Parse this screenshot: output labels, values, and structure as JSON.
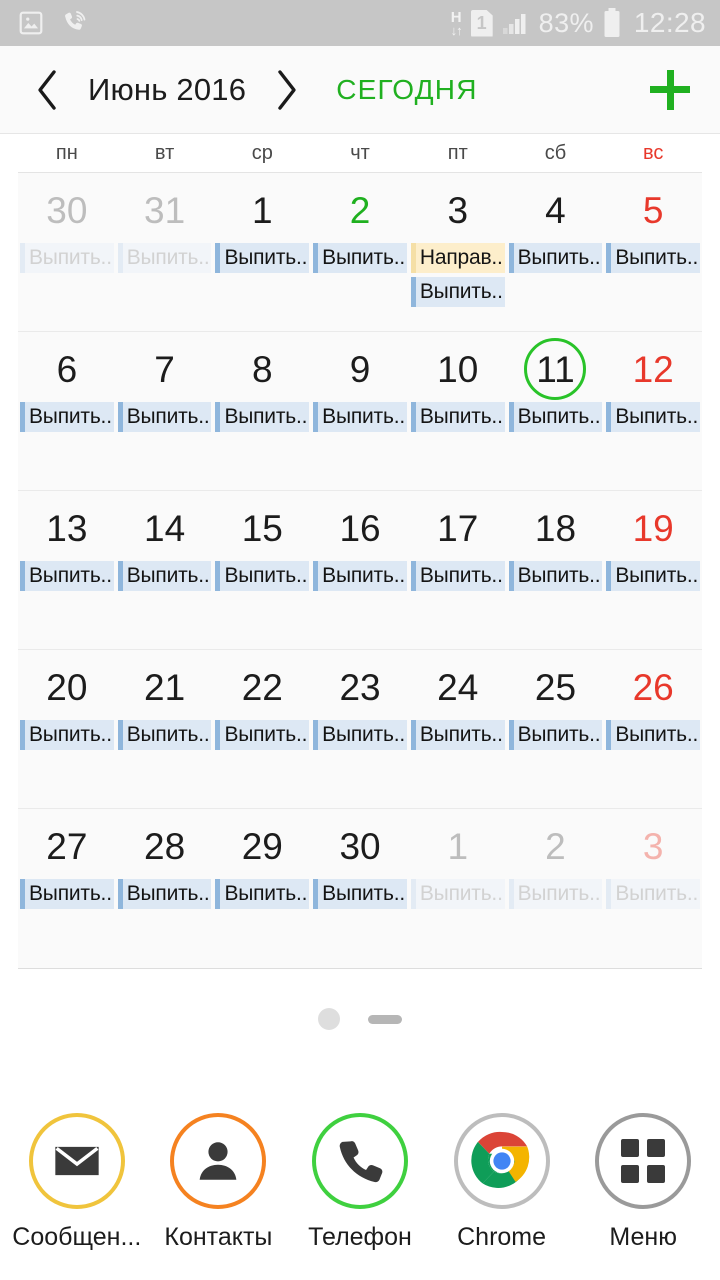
{
  "status_bar": {
    "left_icons": [
      {
        "name": "photo-icon",
        "glyph": "image"
      },
      {
        "name": "call-sound-icon",
        "glyph": "phone-waves"
      }
    ],
    "data_network": "H",
    "data_arrows": "↓↑",
    "sim_slot": "1",
    "signal": "signal-bars",
    "battery_percent": "83%",
    "clock": "12:28",
    "background": "#c6c6c6",
    "foreground": "#efefef"
  },
  "header": {
    "prev_label": "❮",
    "month_title": "Июнь 2016",
    "next_label": "❯",
    "today_label": "СЕГОДНЯ",
    "add_label": "+",
    "accent_color": "#20b020"
  },
  "weekdays": [
    {
      "label": "пн",
      "sunday": false
    },
    {
      "label": "вт",
      "sunday": false
    },
    {
      "label": "ср",
      "sunday": false
    },
    {
      "label": "чт",
      "sunday": false
    },
    {
      "label": "пт",
      "sunday": false
    },
    {
      "label": "сб",
      "sunday": false
    },
    {
      "label": "вс",
      "sunday": true
    }
  ],
  "calendar": {
    "event_drink": "Выпить..",
    "event_send": "Направ..",
    "today_day": "11",
    "weeks": [
      {
        "days": [
          {
            "num": "30",
            "out": true,
            "sunday": false,
            "today": false,
            "green": false,
            "events": [
              {
                "text": "Выпить..",
                "style": "faded"
              }
            ]
          },
          {
            "num": "31",
            "out": true,
            "sunday": false,
            "today": false,
            "green": false,
            "events": [
              {
                "text": "Выпить..",
                "style": "faded"
              }
            ]
          },
          {
            "num": "1",
            "out": false,
            "sunday": false,
            "today": false,
            "green": false,
            "events": [
              {
                "text": "Выпить..",
                "style": "blue"
              }
            ]
          },
          {
            "num": "2",
            "out": false,
            "sunday": false,
            "today": false,
            "green": true,
            "events": [
              {
                "text": "Выпить..",
                "style": "blue"
              }
            ]
          },
          {
            "num": "3",
            "out": false,
            "sunday": false,
            "today": false,
            "green": false,
            "events": [
              {
                "text": "Направ..",
                "style": "tan"
              },
              {
                "text": "Выпить..",
                "style": "blue"
              }
            ]
          },
          {
            "num": "4",
            "out": false,
            "sunday": false,
            "today": false,
            "green": false,
            "events": [
              {
                "text": "Выпить..",
                "style": "blue"
              }
            ]
          },
          {
            "num": "5",
            "out": false,
            "sunday": true,
            "today": false,
            "green": false,
            "events": [
              {
                "text": "Выпить..",
                "style": "blue"
              }
            ]
          }
        ]
      },
      {
        "days": [
          {
            "num": "6",
            "out": false,
            "sunday": false,
            "today": false,
            "green": false,
            "events": [
              {
                "text": "Выпить..",
                "style": "blue"
              }
            ]
          },
          {
            "num": "7",
            "out": false,
            "sunday": false,
            "today": false,
            "green": false,
            "events": [
              {
                "text": "Выпить..",
                "style": "blue"
              }
            ]
          },
          {
            "num": "8",
            "out": false,
            "sunday": false,
            "today": false,
            "green": false,
            "events": [
              {
                "text": "Выпить..",
                "style": "blue"
              }
            ]
          },
          {
            "num": "9",
            "out": false,
            "sunday": false,
            "today": false,
            "green": false,
            "events": [
              {
                "text": "Выпить..",
                "style": "blue"
              }
            ]
          },
          {
            "num": "10",
            "out": false,
            "sunday": false,
            "today": false,
            "green": false,
            "events": [
              {
                "text": "Выпить..",
                "style": "blue"
              }
            ]
          },
          {
            "num": "11",
            "out": false,
            "sunday": false,
            "today": true,
            "green": false,
            "events": [
              {
                "text": "Выпить..",
                "style": "blue"
              }
            ]
          },
          {
            "num": "12",
            "out": false,
            "sunday": true,
            "today": false,
            "green": false,
            "events": [
              {
                "text": "Выпить..",
                "style": "blue"
              }
            ]
          }
        ]
      },
      {
        "days": [
          {
            "num": "13",
            "out": false,
            "sunday": false,
            "today": false,
            "green": false,
            "events": [
              {
                "text": "Выпить..",
                "style": "blue"
              }
            ]
          },
          {
            "num": "14",
            "out": false,
            "sunday": false,
            "today": false,
            "green": false,
            "events": [
              {
                "text": "Выпить..",
                "style": "blue"
              }
            ]
          },
          {
            "num": "15",
            "out": false,
            "sunday": false,
            "today": false,
            "green": false,
            "events": [
              {
                "text": "Выпить..",
                "style": "blue"
              }
            ]
          },
          {
            "num": "16",
            "out": false,
            "sunday": false,
            "today": false,
            "green": false,
            "events": [
              {
                "text": "Выпить..",
                "style": "blue"
              }
            ]
          },
          {
            "num": "17",
            "out": false,
            "sunday": false,
            "today": false,
            "green": false,
            "events": [
              {
                "text": "Выпить..",
                "style": "blue"
              }
            ]
          },
          {
            "num": "18",
            "out": false,
            "sunday": false,
            "today": false,
            "green": false,
            "events": [
              {
                "text": "Выпить..",
                "style": "blue"
              }
            ]
          },
          {
            "num": "19",
            "out": false,
            "sunday": true,
            "today": false,
            "green": false,
            "events": [
              {
                "text": "Выпить..",
                "style": "blue"
              }
            ]
          }
        ]
      },
      {
        "days": [
          {
            "num": "20",
            "out": false,
            "sunday": false,
            "today": false,
            "green": false,
            "events": [
              {
                "text": "Выпить..",
                "style": "blue"
              }
            ]
          },
          {
            "num": "21",
            "out": false,
            "sunday": false,
            "today": false,
            "green": false,
            "events": [
              {
                "text": "Выпить..",
                "style": "blue"
              }
            ]
          },
          {
            "num": "22",
            "out": false,
            "sunday": false,
            "today": false,
            "green": false,
            "events": [
              {
                "text": "Выпить..",
                "style": "blue"
              }
            ]
          },
          {
            "num": "23",
            "out": false,
            "sunday": false,
            "today": false,
            "green": false,
            "events": [
              {
                "text": "Выпить..",
                "style": "blue"
              }
            ]
          },
          {
            "num": "24",
            "out": false,
            "sunday": false,
            "today": false,
            "green": false,
            "events": [
              {
                "text": "Выпить..",
                "style": "blue"
              }
            ]
          },
          {
            "num": "25",
            "out": false,
            "sunday": false,
            "today": false,
            "green": false,
            "events": [
              {
                "text": "Выпить..",
                "style": "blue"
              }
            ]
          },
          {
            "num": "26",
            "out": false,
            "sunday": true,
            "today": false,
            "green": false,
            "events": [
              {
                "text": "Выпить..",
                "style": "blue"
              }
            ]
          }
        ]
      },
      {
        "days": [
          {
            "num": "27",
            "out": false,
            "sunday": false,
            "today": false,
            "green": false,
            "events": [
              {
                "text": "Выпить..",
                "style": "blue"
              }
            ]
          },
          {
            "num": "28",
            "out": false,
            "sunday": false,
            "today": false,
            "green": false,
            "events": [
              {
                "text": "Выпить..",
                "style": "blue"
              }
            ]
          },
          {
            "num": "29",
            "out": false,
            "sunday": false,
            "today": false,
            "green": false,
            "events": [
              {
                "text": "Выпить..",
                "style": "blue"
              }
            ]
          },
          {
            "num": "30",
            "out": false,
            "sunday": false,
            "today": false,
            "green": false,
            "events": [
              {
                "text": "Выпить..",
                "style": "blue"
              }
            ]
          },
          {
            "num": "1",
            "out": true,
            "sunday": false,
            "today": false,
            "green": false,
            "events": [
              {
                "text": "Выпить..",
                "style": "faded"
              }
            ]
          },
          {
            "num": "2",
            "out": true,
            "sunday": false,
            "today": false,
            "green": false,
            "events": [
              {
                "text": "Выпить..",
                "style": "faded"
              }
            ]
          },
          {
            "num": "3",
            "out": true,
            "sunday": true,
            "today": false,
            "green": false,
            "events": [
              {
                "text": "Выпить..",
                "style": "faded"
              }
            ]
          }
        ]
      }
    ]
  },
  "page_indicator": {
    "dots": [
      "circle",
      "pill"
    ]
  },
  "dock": {
    "items": [
      {
        "label": "Сообщен...",
        "icon": "envelope-icon",
        "ring": "#f0c43c",
        "key": "msg"
      },
      {
        "label": "Контакты",
        "icon": "person-icon",
        "ring": "#f58220",
        "key": "con"
      },
      {
        "label": "Телефон",
        "icon": "phone-icon",
        "ring": "#3fd03f",
        "key": "tel"
      },
      {
        "label": "Chrome",
        "icon": "chrome-icon",
        "ring": "#bdbdbd",
        "key": "chr"
      },
      {
        "label": "Меню",
        "icon": "apps-grid-icon",
        "ring": "#9a9a9a",
        "key": "men"
      }
    ]
  }
}
